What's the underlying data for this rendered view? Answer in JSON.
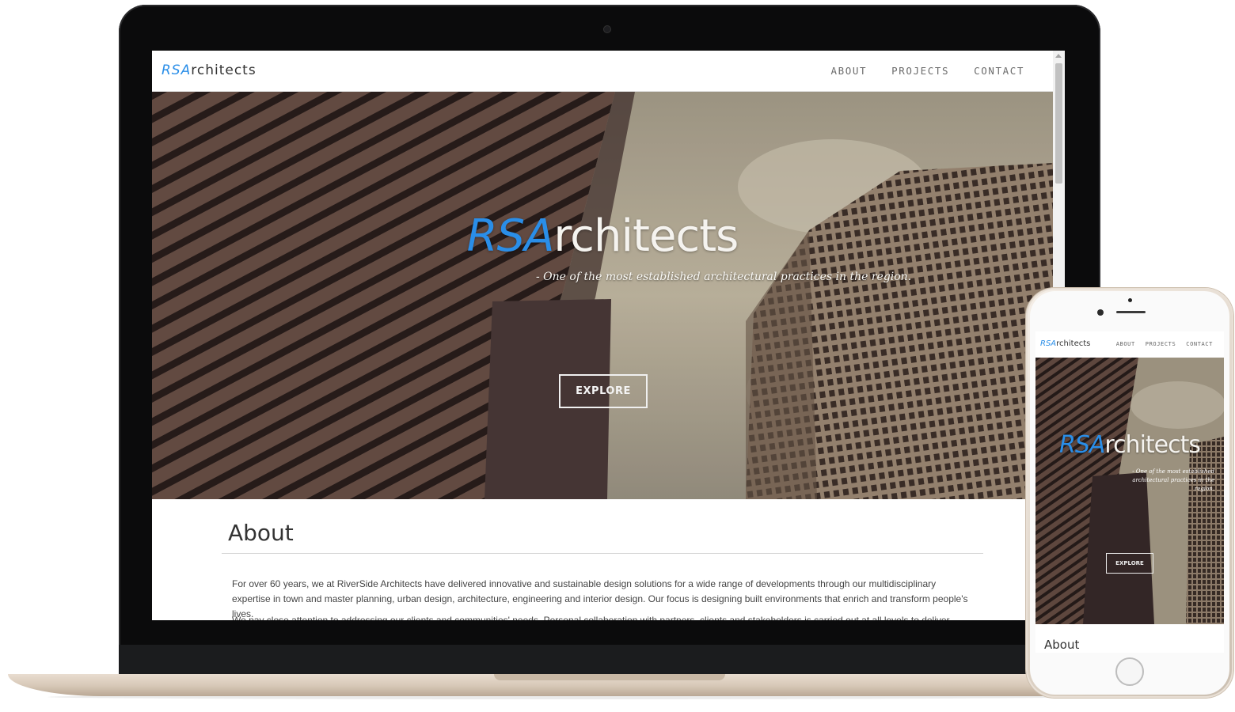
{
  "site": {
    "brand_prefix": "RS",
    "brand_suffix": "rchitects",
    "brand_a": "A"
  },
  "nav": {
    "items": [
      "ABOUT",
      "PROJECTS",
      "CONTACT"
    ]
  },
  "hero": {
    "title_prefix": "RSA",
    "title_suffix": "rchitects",
    "tagline": "- One of the most established architectural practices in the region.",
    "button_label": "EXPLORE"
  },
  "about": {
    "heading": "About",
    "paragraph1": "For over 60 years, we at RiverSide Architects have delivered innovative and sustainable design solutions for a wide range of developments through our multidisciplinary expertise in town and master planning, urban design, architecture, engineering and interior design. Our focus is designing built environments that enrich and transform people's lives.",
    "paragraph2": "We pay close attention to addressing our clients and communities' needs. Personal collaboration with partners, clients and stakeholders is carried out at all levels to deliver quality"
  },
  "phone": {
    "brand_prefix": "RSA",
    "brand_suffix": "rchitects",
    "nav_items": [
      "ABOUT",
      "PROJECTS",
      "CONTACT"
    ],
    "title_prefix": "RSA",
    "title_suffix": "rchitects",
    "tagline": "- One of the most established architectural practices in the region.",
    "button_label": "EXPLORE",
    "about_heading": "About"
  },
  "colors": {
    "accent": "#2a8ee8",
    "laptop_bezel": "#0b0b0c",
    "device_gold": "#d8c9b8"
  }
}
